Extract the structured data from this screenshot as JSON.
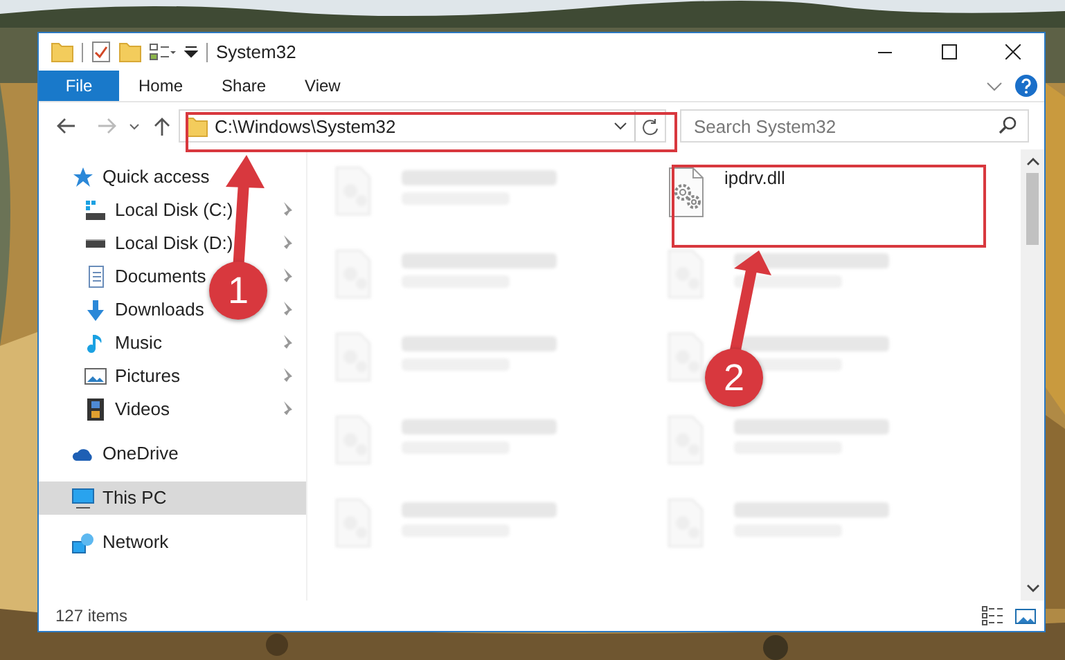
{
  "window": {
    "title": "System32"
  },
  "ribbon_tabs": [
    {
      "label": "File",
      "kind": "file",
      "selected": false
    },
    {
      "label": "Home",
      "kind": "tab",
      "selected": false
    },
    {
      "label": "Share",
      "kind": "tab",
      "selected": false
    },
    {
      "label": "View",
      "kind": "tab",
      "selected": false
    }
  ],
  "address_bar": {
    "path": "C:\\Windows\\System32"
  },
  "search": {
    "placeholder": "Search System32"
  },
  "sidebar": {
    "items": [
      {
        "label": "Quick access",
        "selected": false,
        "children": [
          {
            "label": "Local Disk (C:)",
            "pinned": true,
            "selected": false
          },
          {
            "label": "Local Disk (D:)",
            "pinned": true,
            "selected": false
          },
          {
            "label": "Documents",
            "pinned": true,
            "selected": false
          },
          {
            "label": "Downloads",
            "pinned": true,
            "selected": false
          },
          {
            "label": "Music",
            "pinned": true,
            "selected": false
          },
          {
            "label": "Pictures",
            "pinned": true,
            "selected": false
          },
          {
            "label": "Videos",
            "pinned": true,
            "selected": false
          }
        ]
      },
      {
        "label": "OneDrive",
        "selected": false
      },
      {
        "label": "This PC",
        "selected": true
      },
      {
        "label": "Network",
        "selected": false
      }
    ]
  },
  "files": [
    {
      "kind": "blurred"
    },
    {
      "kind": "file",
      "name": "ipdrv.dll"
    },
    {
      "kind": "blurred"
    },
    {
      "kind": "blurred"
    },
    {
      "kind": "blurred"
    },
    {
      "kind": "blurred"
    },
    {
      "kind": "blurred"
    },
    {
      "kind": "blurred"
    },
    {
      "kind": "blurred"
    },
    {
      "kind": "blurred"
    }
  ],
  "status_bar": {
    "item_count": "127 items"
  },
  "step_markers": [
    {
      "label": "1"
    },
    {
      "label": "2"
    }
  ]
}
